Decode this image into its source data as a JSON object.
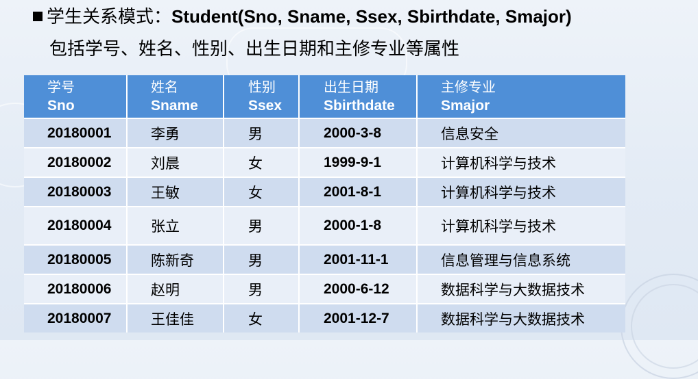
{
  "heading": {
    "prefix": "学生关系模式：",
    "schema": "Student(Sno, Sname, Ssex, Sbirthdate, Smajor)"
  },
  "subheading": "包括学号、姓名、性别、出生日期和主修专业等属性",
  "table": {
    "columns": [
      {
        "cn": "学号",
        "en": "Sno"
      },
      {
        "cn": "姓名",
        "en": "Sname"
      },
      {
        "cn": "性别",
        "en": "Ssex"
      },
      {
        "cn": "出生日期",
        "en": "Sbirthdate"
      },
      {
        "cn": "主修专业",
        "en": "Smajor"
      }
    ],
    "rows": [
      {
        "sno": "20180001",
        "sname": "李勇",
        "ssex": "男",
        "bd": "2000-3-8",
        "major": "信息安全"
      },
      {
        "sno": "20180002",
        "sname": "刘晨",
        "ssex": "女",
        "bd": "1999-9-1",
        "major": "计算机科学与技术"
      },
      {
        "sno": "20180003",
        "sname": "王敏",
        "ssex": "女",
        "bd": "2001-8-1",
        "major": "计算机科学与技术"
      },
      {
        "sno": "20180004",
        "sname": "张立",
        "ssex": "男",
        "bd": "2000-1-8",
        "major": "计算机科学与技术"
      },
      {
        "sno": "20180005",
        "sname": "陈新奇",
        "ssex": "男",
        "bd": "2001-11-1",
        "major": "信息管理与信息系统"
      },
      {
        "sno": "20180006",
        "sname": "赵明",
        "ssex": "男",
        "bd": "2000-6-12",
        "major": "数据科学与大数据技术"
      },
      {
        "sno": "20180007",
        "sname": "王佳佳",
        "ssex": "女",
        "bd": "2001-12-7",
        "major": "数据科学与大数据技术"
      }
    ]
  }
}
